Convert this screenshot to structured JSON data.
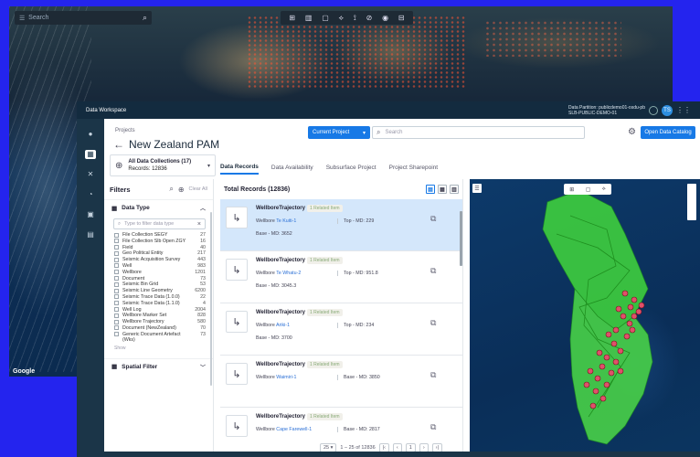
{
  "background_map": {
    "search_placeholder": "Search",
    "google": "Google",
    "toolbar_icons": [
      "⊞",
      "▥",
      "▢",
      "⟡",
      "⟟",
      "⊘",
      "◉",
      "⊟"
    ]
  },
  "app": {
    "window_title": "Data Workspace",
    "partition_label": "Data Partition: publicdemo01-osdu-pb",
    "partition_sub": "SLB-PUBLIC-DEMO-01",
    "user_initials": "TS"
  },
  "header": {
    "projects_label": "Projects",
    "title": "New Zealand PAM",
    "project_select": "Current Project",
    "search_placeholder": "Search",
    "catalog_button": "Open Data Catalog"
  },
  "collections": {
    "label": "All Data Collections (17)",
    "records": "Records: 12836"
  },
  "tabs": [
    "Data Records",
    "Data Availability",
    "Subsurface Project",
    "Project Sharepoint"
  ],
  "filters": {
    "title": "Filters",
    "clear_all": "Clear All",
    "data_type_label": "Data Type",
    "type_search_placeholder": "Type to filter data type",
    "types": [
      {
        "name": "File Collection SEGY",
        "count": "27"
      },
      {
        "name": "File Collection Slb Open ZGY",
        "count": "16"
      },
      {
        "name": "Field",
        "count": "40"
      },
      {
        "name": "Geo Political Entity",
        "count": "217"
      },
      {
        "name": "Seismic Acquisition Survey",
        "count": "443"
      },
      {
        "name": "Well",
        "count": "983"
      },
      {
        "name": "Wellbore",
        "count": "1201"
      },
      {
        "name": "Document",
        "count": "73"
      },
      {
        "name": "Seismic Bin Grid",
        "count": "53"
      },
      {
        "name": "Seismic Line Geometry",
        "count": "6200"
      },
      {
        "name": "Seismic Trace Data (1.0.0)",
        "count": "22"
      },
      {
        "name": "Seismic Trace Data (1.1.0)",
        "count": "4"
      },
      {
        "name": "Well Log",
        "count": "2004"
      },
      {
        "name": "Wellbore Marker Set",
        "count": "828"
      },
      {
        "name": "Wellbore Trajectory",
        "count": "580"
      },
      {
        "name": "Document (NewZealand)",
        "count": "70"
      },
      {
        "name": "Generic Document Artefact (Wks)",
        "count": "73"
      }
    ],
    "show_less": "Show",
    "spatial_filter_label": "Spatial Filter"
  },
  "records": {
    "total_label": "Total Records (12836)",
    "items": [
      {
        "kind": "WellboreTrajectory",
        "related": "1 Related Item",
        "wellbore_label": "Wellbore",
        "wellbore": "Te Kuiti-1",
        "top": "Top - MD: 229",
        "base": "Base - MD: 3652",
        "selected": true
      },
      {
        "kind": "WellboreTrajectory",
        "related": "1 Related Item",
        "wellbore_label": "Wellbore",
        "wellbore": "Te Whatu-2",
        "top": "Top - MD: 951.8",
        "base": "Base - MD: 3045.3",
        "selected": false
      },
      {
        "kind": "WellboreTrajectory",
        "related": "1 Related Item",
        "wellbore_label": "Wellbore",
        "wellbore": "Ariki-1",
        "top": "Top - MD: 234",
        "base": "Base - MD: 3700",
        "selected": false
      },
      {
        "kind": "WellboreTrajectory",
        "related": "1 Related Item",
        "wellbore_label": "Wellbore",
        "wellbore": "Waimiri-1",
        "top": "Base - MD: 3850",
        "base": "",
        "selected": false
      },
      {
        "kind": "WellboreTrajectory",
        "related": "1 Related Item",
        "wellbore_label": "Wellbore",
        "wellbore": "Cape Farewell-1",
        "top": "Base - MD: 2817",
        "base": "",
        "selected": false
      }
    ],
    "pager": {
      "page_size": "25",
      "range": "1 – 25 of 12836",
      "page": "1"
    }
  },
  "map": {
    "toolbar": [
      "⊞",
      "▢",
      "⟡"
    ]
  }
}
